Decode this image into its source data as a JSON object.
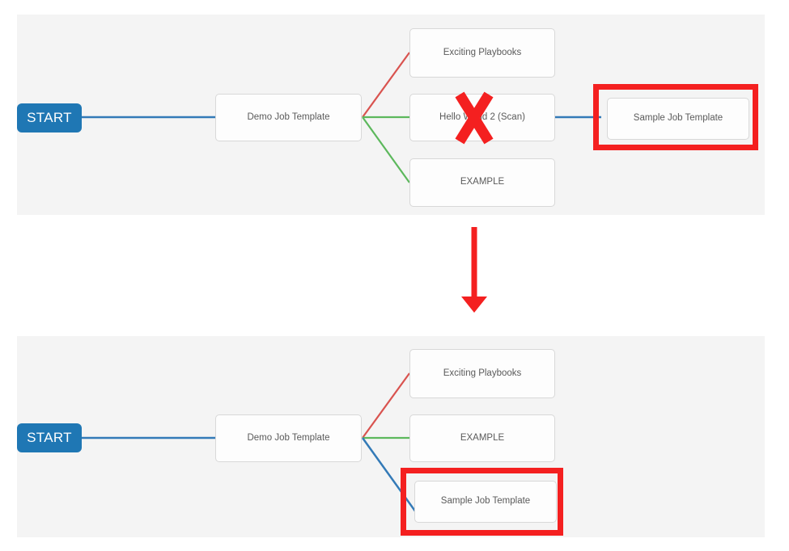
{
  "diagram": {
    "type": "workflow-visualizer",
    "title_top": "",
    "title_bottom": "",
    "colors": {
      "panel_background": "#f4f4f4",
      "start_node": "#1f77b4",
      "node_fill": "#fdfdfd",
      "node_border": "#d8d8d8",
      "node_text": "#5a5a5a",
      "edge_success": "#5cb85c",
      "edge_failure": "#d9534f",
      "edge_always": "#337ab7",
      "highlight": "#f42020",
      "delete_mark": "#f42020"
    },
    "before": {
      "start_label": "START",
      "root_node": "Demo Job Template",
      "children": [
        {
          "label": "Exciting Playbooks",
          "edge_type": "failure",
          "edge_color": "#d9534f",
          "highlighted": false
        },
        {
          "label": "Hello World 2 (Scan)",
          "edge_type": "success",
          "edge_color": "#5cb85c",
          "highlighted": false,
          "marked_for_removal": true,
          "mark": "X"
        },
        {
          "label": "EXAMPLE",
          "edge_type": "success",
          "edge_color": "#5cb85c",
          "highlighted": false
        }
      ],
      "grandchildren": [
        {
          "label": "Sample Job Template",
          "parent": "Hello World 2 (Scan)",
          "edge_type": "always",
          "edge_color": "#337ab7",
          "highlighted": true
        }
      ]
    },
    "transition": {
      "arrow_direction": "down",
      "arrow_color": "#f42020"
    },
    "after": {
      "start_label": "START",
      "root_node": "Demo Job Template",
      "children": [
        {
          "label": "Exciting Playbooks",
          "edge_type": "failure",
          "edge_color": "#d9534f",
          "highlighted": false
        },
        {
          "label": "EXAMPLE",
          "edge_type": "success",
          "edge_color": "#5cb85c",
          "highlighted": false
        },
        {
          "label": "Sample Job Template",
          "edge_type": "always",
          "edge_color": "#337ab7",
          "highlighted": true
        }
      ],
      "grandchildren": []
    }
  }
}
